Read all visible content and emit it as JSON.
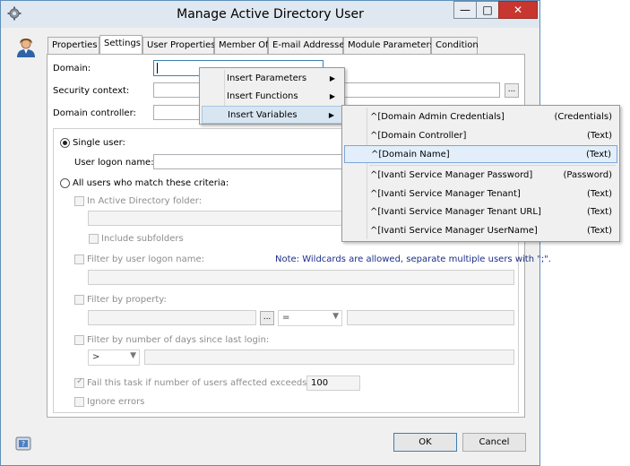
{
  "window": {
    "title": "Manage Active Directory User",
    "minimize": "—",
    "maximize": "□",
    "close": "✕"
  },
  "tabs": [
    "Properties",
    "Settings",
    "User Properties",
    "Member Of",
    "E-mail Addresses",
    "Module Parameters",
    "Condition"
  ],
  "fields": {
    "domain_label": "Domain:",
    "security_label": "Security context:",
    "dc_label": "Domain controller:",
    "dots": "..."
  },
  "single_user": {
    "label": "Single user:",
    "logon_label": "User logon name:"
  },
  "all_users": {
    "label": "All users who match these criteria:",
    "in_folder": "In Active Directory folder:",
    "include_subfolders": "Include subfolders",
    "filter_logon": "Filter by user logon name:",
    "note": "Note: Wildcards are allowed, separate multiple users with \";\".",
    "filter_property": "Filter by property:",
    "property_op": "=",
    "filter_days": "Filter by number of days since last login:",
    "days_op": ">",
    "fail_task": "Fail this task if number of users affected exceeds:",
    "fail_value": "100",
    "ignore_errors": "Ignore errors"
  },
  "buttons": {
    "ok": "OK",
    "cancel": "Cancel"
  },
  "context_menu": {
    "items": [
      "Insert Parameters",
      "Insert Functions",
      "Insert Variables"
    ],
    "arrow": "▶"
  },
  "variables": [
    {
      "name": "^[Domain Admin Credentials]",
      "type": "(Credentials)"
    },
    {
      "name": "^[Domain Controller]",
      "type": "(Text)"
    },
    {
      "name": "^[Domain Name]",
      "type": "(Text)"
    },
    {
      "name": "^[Ivanti Service Manager Password]",
      "type": "(Password)"
    },
    {
      "name": "^[Ivanti Service Manager Tenant]",
      "type": "(Text)"
    },
    {
      "name": "^[Ivanti Service Manager Tenant URL]",
      "type": "(Text)"
    },
    {
      "name": "^[Ivanti Service Manager UserName]",
      "type": "(Text)"
    }
  ],
  "icons": {
    "app": "gear-icon",
    "user": "user-avatar-icon",
    "help": "help-icon"
  }
}
